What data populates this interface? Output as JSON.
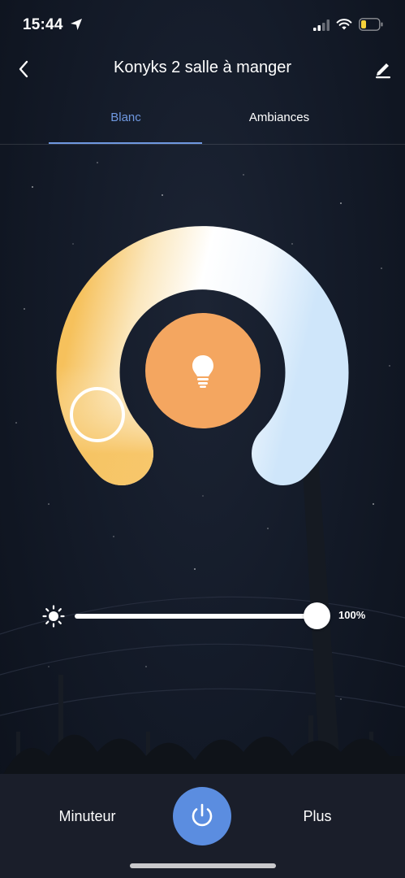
{
  "status_bar": {
    "time": "15:44",
    "location_icon": "location-arrow-icon",
    "signal_icon": "cellular-signal-icon",
    "wifi_icon": "wifi-icon",
    "battery_icon": "battery-low-icon",
    "battery_color": "#f7d23a"
  },
  "header": {
    "back_icon": "chevron-left-icon",
    "title": "Konyks 2 salle à manger",
    "edit_icon": "pencil-icon"
  },
  "tabs": [
    {
      "label": "Blanc",
      "active": true
    },
    {
      "label": "Ambiances",
      "active": false
    }
  ],
  "accent_color": "#6f98e0",
  "color_wheel": {
    "warm_color": "#f6c15c",
    "cool_color": "#cfe6fa",
    "center_icon": "lightbulb-icon",
    "center_color": "#f4a660",
    "selected_temperature": "warm"
  },
  "brightness": {
    "icon": "sun-icon",
    "value": 100,
    "label": "100%"
  },
  "bottom_bar": {
    "timer_label": "Minuteur",
    "power_icon": "power-icon",
    "power_color": "#5b8de0",
    "more_label": "Plus"
  }
}
